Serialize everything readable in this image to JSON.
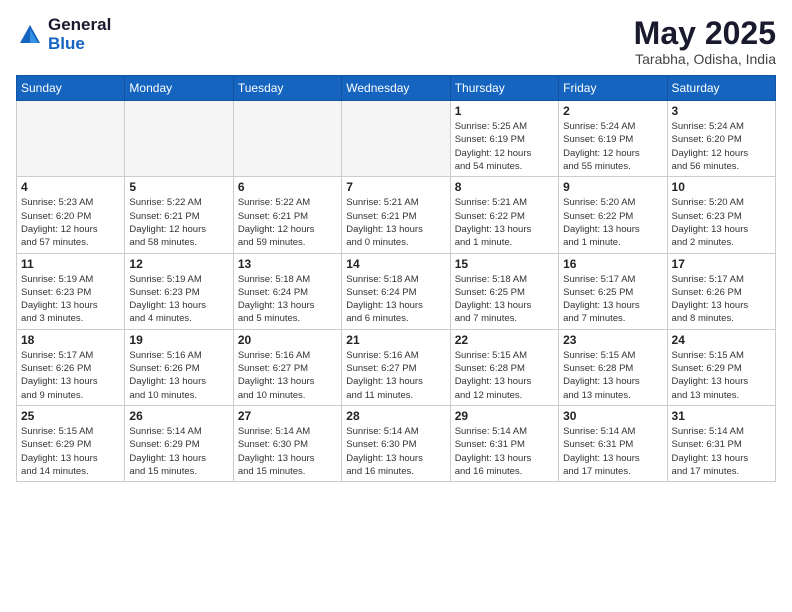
{
  "header": {
    "logo_general": "General",
    "logo_blue": "Blue",
    "month": "May 2025",
    "location": "Tarabha, Odisha, India"
  },
  "weekdays": [
    "Sunday",
    "Monday",
    "Tuesday",
    "Wednesday",
    "Thursday",
    "Friday",
    "Saturday"
  ],
  "weeks": [
    [
      {
        "day": "",
        "info": ""
      },
      {
        "day": "",
        "info": ""
      },
      {
        "day": "",
        "info": ""
      },
      {
        "day": "",
        "info": ""
      },
      {
        "day": "1",
        "info": "Sunrise: 5:25 AM\nSunset: 6:19 PM\nDaylight: 12 hours\nand 54 minutes."
      },
      {
        "day": "2",
        "info": "Sunrise: 5:24 AM\nSunset: 6:19 PM\nDaylight: 12 hours\nand 55 minutes."
      },
      {
        "day": "3",
        "info": "Sunrise: 5:24 AM\nSunset: 6:20 PM\nDaylight: 12 hours\nand 56 minutes."
      }
    ],
    [
      {
        "day": "4",
        "info": "Sunrise: 5:23 AM\nSunset: 6:20 PM\nDaylight: 12 hours\nand 57 minutes."
      },
      {
        "day": "5",
        "info": "Sunrise: 5:22 AM\nSunset: 6:21 PM\nDaylight: 12 hours\nand 58 minutes."
      },
      {
        "day": "6",
        "info": "Sunrise: 5:22 AM\nSunset: 6:21 PM\nDaylight: 12 hours\nand 59 minutes."
      },
      {
        "day": "7",
        "info": "Sunrise: 5:21 AM\nSunset: 6:21 PM\nDaylight: 13 hours\nand 0 minutes."
      },
      {
        "day": "8",
        "info": "Sunrise: 5:21 AM\nSunset: 6:22 PM\nDaylight: 13 hours\nand 1 minute."
      },
      {
        "day": "9",
        "info": "Sunrise: 5:20 AM\nSunset: 6:22 PM\nDaylight: 13 hours\nand 1 minute."
      },
      {
        "day": "10",
        "info": "Sunrise: 5:20 AM\nSunset: 6:23 PM\nDaylight: 13 hours\nand 2 minutes."
      }
    ],
    [
      {
        "day": "11",
        "info": "Sunrise: 5:19 AM\nSunset: 6:23 PM\nDaylight: 13 hours\nand 3 minutes."
      },
      {
        "day": "12",
        "info": "Sunrise: 5:19 AM\nSunset: 6:23 PM\nDaylight: 13 hours\nand 4 minutes."
      },
      {
        "day": "13",
        "info": "Sunrise: 5:18 AM\nSunset: 6:24 PM\nDaylight: 13 hours\nand 5 minutes."
      },
      {
        "day": "14",
        "info": "Sunrise: 5:18 AM\nSunset: 6:24 PM\nDaylight: 13 hours\nand 6 minutes."
      },
      {
        "day": "15",
        "info": "Sunrise: 5:18 AM\nSunset: 6:25 PM\nDaylight: 13 hours\nand 7 minutes."
      },
      {
        "day": "16",
        "info": "Sunrise: 5:17 AM\nSunset: 6:25 PM\nDaylight: 13 hours\nand 7 minutes."
      },
      {
        "day": "17",
        "info": "Sunrise: 5:17 AM\nSunset: 6:26 PM\nDaylight: 13 hours\nand 8 minutes."
      }
    ],
    [
      {
        "day": "18",
        "info": "Sunrise: 5:17 AM\nSunset: 6:26 PM\nDaylight: 13 hours\nand 9 minutes."
      },
      {
        "day": "19",
        "info": "Sunrise: 5:16 AM\nSunset: 6:26 PM\nDaylight: 13 hours\nand 10 minutes."
      },
      {
        "day": "20",
        "info": "Sunrise: 5:16 AM\nSunset: 6:27 PM\nDaylight: 13 hours\nand 10 minutes."
      },
      {
        "day": "21",
        "info": "Sunrise: 5:16 AM\nSunset: 6:27 PM\nDaylight: 13 hours\nand 11 minutes."
      },
      {
        "day": "22",
        "info": "Sunrise: 5:15 AM\nSunset: 6:28 PM\nDaylight: 13 hours\nand 12 minutes."
      },
      {
        "day": "23",
        "info": "Sunrise: 5:15 AM\nSunset: 6:28 PM\nDaylight: 13 hours\nand 13 minutes."
      },
      {
        "day": "24",
        "info": "Sunrise: 5:15 AM\nSunset: 6:29 PM\nDaylight: 13 hours\nand 13 minutes."
      }
    ],
    [
      {
        "day": "25",
        "info": "Sunrise: 5:15 AM\nSunset: 6:29 PM\nDaylight: 13 hours\nand 14 minutes."
      },
      {
        "day": "26",
        "info": "Sunrise: 5:14 AM\nSunset: 6:29 PM\nDaylight: 13 hours\nand 15 minutes."
      },
      {
        "day": "27",
        "info": "Sunrise: 5:14 AM\nSunset: 6:30 PM\nDaylight: 13 hours\nand 15 minutes."
      },
      {
        "day": "28",
        "info": "Sunrise: 5:14 AM\nSunset: 6:30 PM\nDaylight: 13 hours\nand 16 minutes."
      },
      {
        "day": "29",
        "info": "Sunrise: 5:14 AM\nSunset: 6:31 PM\nDaylight: 13 hours\nand 16 minutes."
      },
      {
        "day": "30",
        "info": "Sunrise: 5:14 AM\nSunset: 6:31 PM\nDaylight: 13 hours\nand 17 minutes."
      },
      {
        "day": "31",
        "info": "Sunrise: 5:14 AM\nSunset: 6:31 PM\nDaylight: 13 hours\nand 17 minutes."
      }
    ]
  ]
}
